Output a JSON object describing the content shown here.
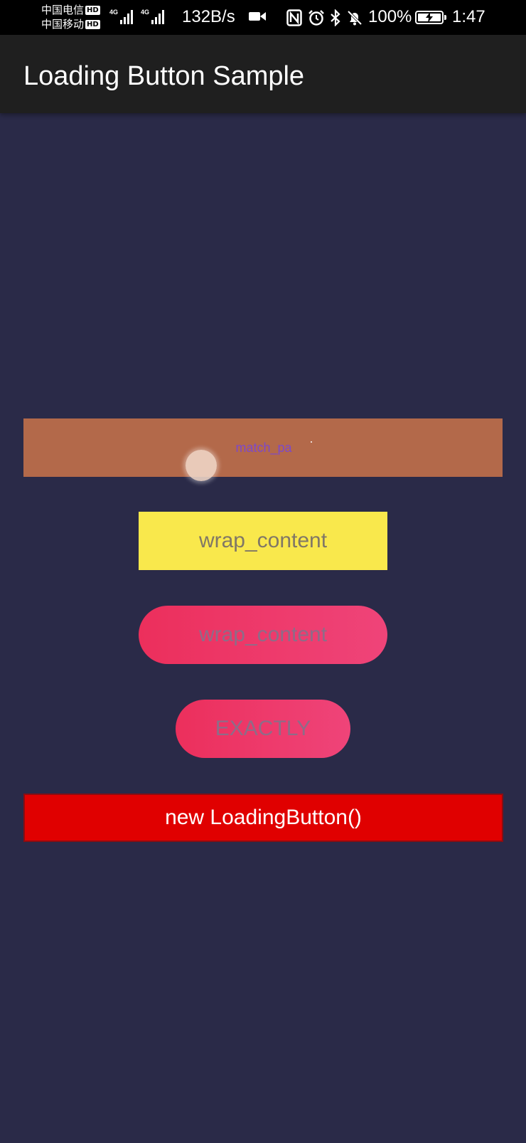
{
  "status_bar": {
    "carrier_1": "中国电信",
    "carrier_2": "中国移动",
    "hd_badge": "HD",
    "network_type": "4G",
    "network_speed": "132B/s",
    "battery_percent": "100%",
    "time": "1:47",
    "icons": [
      "video-camera-icon",
      "nfc-icon",
      "alarm-icon",
      "bluetooth-icon",
      "mute-bell-icon",
      "battery-charging-icon"
    ]
  },
  "app_bar": {
    "title": "Loading Button Sample"
  },
  "buttons": {
    "match_parent": {
      "label": "match_pa",
      "color": "#b3694a",
      "label_color": "#7d49c9"
    },
    "wrap_content_rect": {
      "label": "wrap_content",
      "color": "#f9e84c"
    },
    "wrap_content_round": {
      "label": "wrap_content",
      "gradient": [
        "#ec2f5c",
        "#ef4479"
      ]
    },
    "exactly": {
      "label": "EXACTLY",
      "gradient": [
        "#ec2f5c",
        "#ef4479"
      ]
    },
    "new_loading_button": {
      "label": "new LoadingButton()",
      "color": "#e00000"
    }
  },
  "colors": {
    "background": "#2a2a48",
    "app_bar": "#1f1f1f"
  }
}
